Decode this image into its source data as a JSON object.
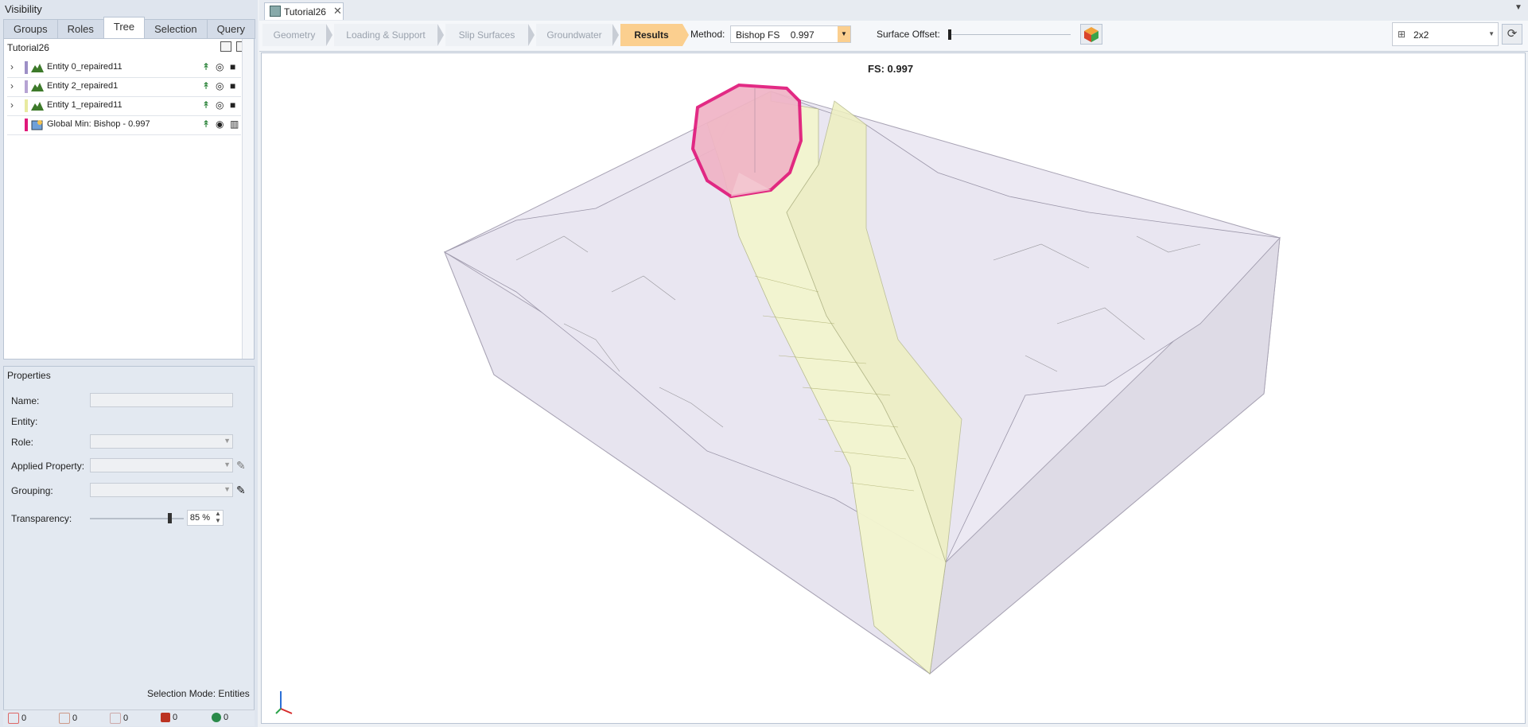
{
  "visibility": {
    "header": "Visibility",
    "tabs": [
      {
        "label": "Groups"
      },
      {
        "label": "Roles"
      },
      {
        "label": "Tree"
      },
      {
        "label": "Selection"
      },
      {
        "label": "Query"
      }
    ],
    "active_tab": "Tree"
  },
  "tree": {
    "root": "Tutorial26",
    "items": [
      {
        "label": "Entity 0_repaired11",
        "color": "#9d8fc6",
        "expandable": true
      },
      {
        "label": "Entity 2_repaired1",
        "color": "#b6a3d3",
        "expandable": true
      },
      {
        "label": "Entity 1_repaired11",
        "color": "#e8eaa0",
        "expandable": true
      },
      {
        "label": "Global Min: Bishop  -  0.997",
        "color": "#e0187a",
        "expandable": false
      }
    ]
  },
  "properties": {
    "header": "Properties",
    "name_label": "Name:",
    "entity_label": "Entity:",
    "role_label": "Role:",
    "applied_property_label": "Applied Property:",
    "grouping_label": "Grouping:",
    "transparency_label": "Transparency:",
    "transparency_value": "85 %",
    "transparency_level": 0.85
  },
  "status": {
    "selection_mode_label": "Selection Mode:",
    "selection_mode_value": "Entities",
    "counters": [
      "0",
      "0",
      "0",
      "0",
      "0"
    ]
  },
  "document": {
    "tab_title": "Tutorial26"
  },
  "workflow": {
    "steps": [
      "Geometry",
      "Loading & Support",
      "Slip Surfaces",
      "Groundwater",
      "Results"
    ],
    "active": "Results"
  },
  "toolbar": {
    "method_label": "Method:",
    "method_value": "Bishop FS    0.997",
    "surface_offset_label": "Surface Offset:",
    "surface_offset_level": 0,
    "layout_value": "2x2"
  },
  "viewport": {
    "fs_label": "FS: 0.997"
  },
  "colors": {
    "accent": "#fbcf8f",
    "slip_surface": "#e0187a"
  }
}
